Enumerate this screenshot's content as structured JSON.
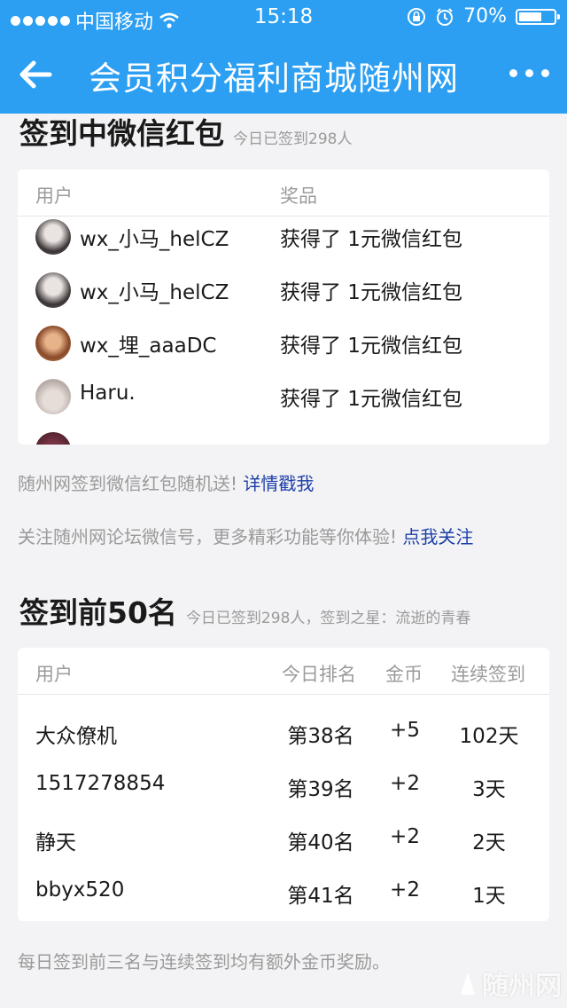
{
  "status": {
    "carrier": "中国移动",
    "time": "15:18",
    "battery": "70%",
    "battery_level": 0.7
  },
  "nav": {
    "title": "会员积分福利商城随州网"
  },
  "hongbao": {
    "title": "签到中微信红包",
    "subtitle": "今日已签到298人",
    "col_user": "用户",
    "col_prize": "奖品",
    "rows": [
      {
        "user": "wx_小马_helCZ",
        "prize": "获得了 1元微信红包"
      },
      {
        "user": "wx_小马_helCZ",
        "prize": "获得了 1元微信红包"
      },
      {
        "user": "wx_埋_aaaDC",
        "prize": "获得了 1元微信红包"
      },
      {
        "user": "Haru.",
        "prize": "获得了 1元微信红包"
      }
    ]
  },
  "notes": {
    "line1": "随州网签到微信红包随机送!",
    "line1_link": "详情戳我",
    "line2": "关注随州网论坛微信号，更多精彩功能等你体验!",
    "line2_link": "点我关注",
    "footer": "每日签到前三名与连续签到均有额外金币奖励。"
  },
  "top50": {
    "title": "签到前50名",
    "subtitle": "今日已签到298人，签到之星：流逝的青春",
    "col_user": "用户",
    "col_rank": "今日排名",
    "col_coins": "金币",
    "col_streak": "连续签到",
    "rows": [
      {
        "user": "大众僚机",
        "rank": "第38名",
        "coins": "+5",
        "streak": "102天"
      },
      {
        "user": "1517278854",
        "rank": "第39名",
        "coins": "+2",
        "streak": "3天"
      },
      {
        "user": "静天",
        "rank": "第40名",
        "coins": "+2",
        "streak": "2天"
      },
      {
        "user": "bbyx520",
        "rank": "第41名",
        "coins": "+2",
        "streak": "1天"
      }
    ]
  },
  "watermark": "随州网"
}
